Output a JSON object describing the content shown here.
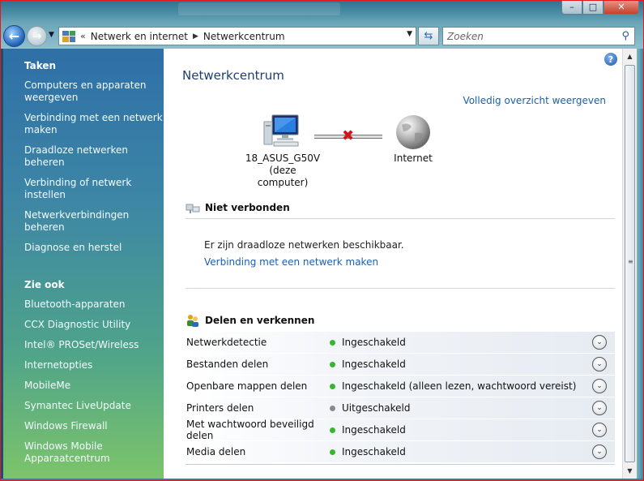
{
  "window": {
    "minimize_icon": "minimize-icon",
    "maximize_icon": "maximize-icon",
    "close_icon": "close-icon"
  },
  "address": {
    "overflow": "«",
    "crumbs": [
      "Netwerk en internet",
      "Netwerkcentrum"
    ],
    "search_placeholder": "Zoeken"
  },
  "sidebar": {
    "tasks_title": "Taken",
    "tasks": [
      "Computers en apparaten weergeven",
      "Verbinding met een netwerk maken",
      "Draadloze netwerken beheren",
      "Verbinding of netwerk instellen",
      "Netwerkverbindingen beheren",
      "Diagnose en herstel"
    ],
    "see_also_title": "Zie ook",
    "see_also": [
      "Bluetooth-apparaten",
      "CCX Diagnostic Utility",
      "Intel® PROSet/Wireless",
      "Internetopties",
      "MobileMe",
      "Symantec LiveUpdate",
      "Windows Firewall",
      "Windows Mobile Apparaatcentrum"
    ]
  },
  "main": {
    "title": "Netwerkcentrum",
    "overview_link": "Volledig overzicht weergeven",
    "computer_name": "18_ASUS_G50V",
    "computer_sub": "(deze computer)",
    "internet_label": "Internet",
    "not_connected_title": "Niet verbonden",
    "wireless_available": "Er zijn draadloze netwerken beschikbaar.",
    "connect_link": "Verbinding met een netwerk maken",
    "sharing_title": "Delen en verkennen",
    "sharing": [
      {
        "name": "Netwerkdetectie",
        "status": "Ingeschakeld",
        "on": true
      },
      {
        "name": "Bestanden delen",
        "status": "Ingeschakeld",
        "on": true
      },
      {
        "name": "Openbare mappen delen",
        "status": "Ingeschakeld (alleen lezen, wachtwoord vereist)",
        "on": true
      },
      {
        "name": "Printers delen",
        "status": "Uitgeschakeld",
        "on": false
      },
      {
        "name": "Met wachtwoord beveiligd delen",
        "status": "Ingeschakeld",
        "on": true
      },
      {
        "name": "Media delen",
        "status": "Ingeschakeld",
        "on": true
      }
    ]
  },
  "colors": {
    "link": "#1a5fb4",
    "on_dot": "#38b62b",
    "off_dot": "#8a8a8a",
    "error_x": "#d0141b"
  }
}
